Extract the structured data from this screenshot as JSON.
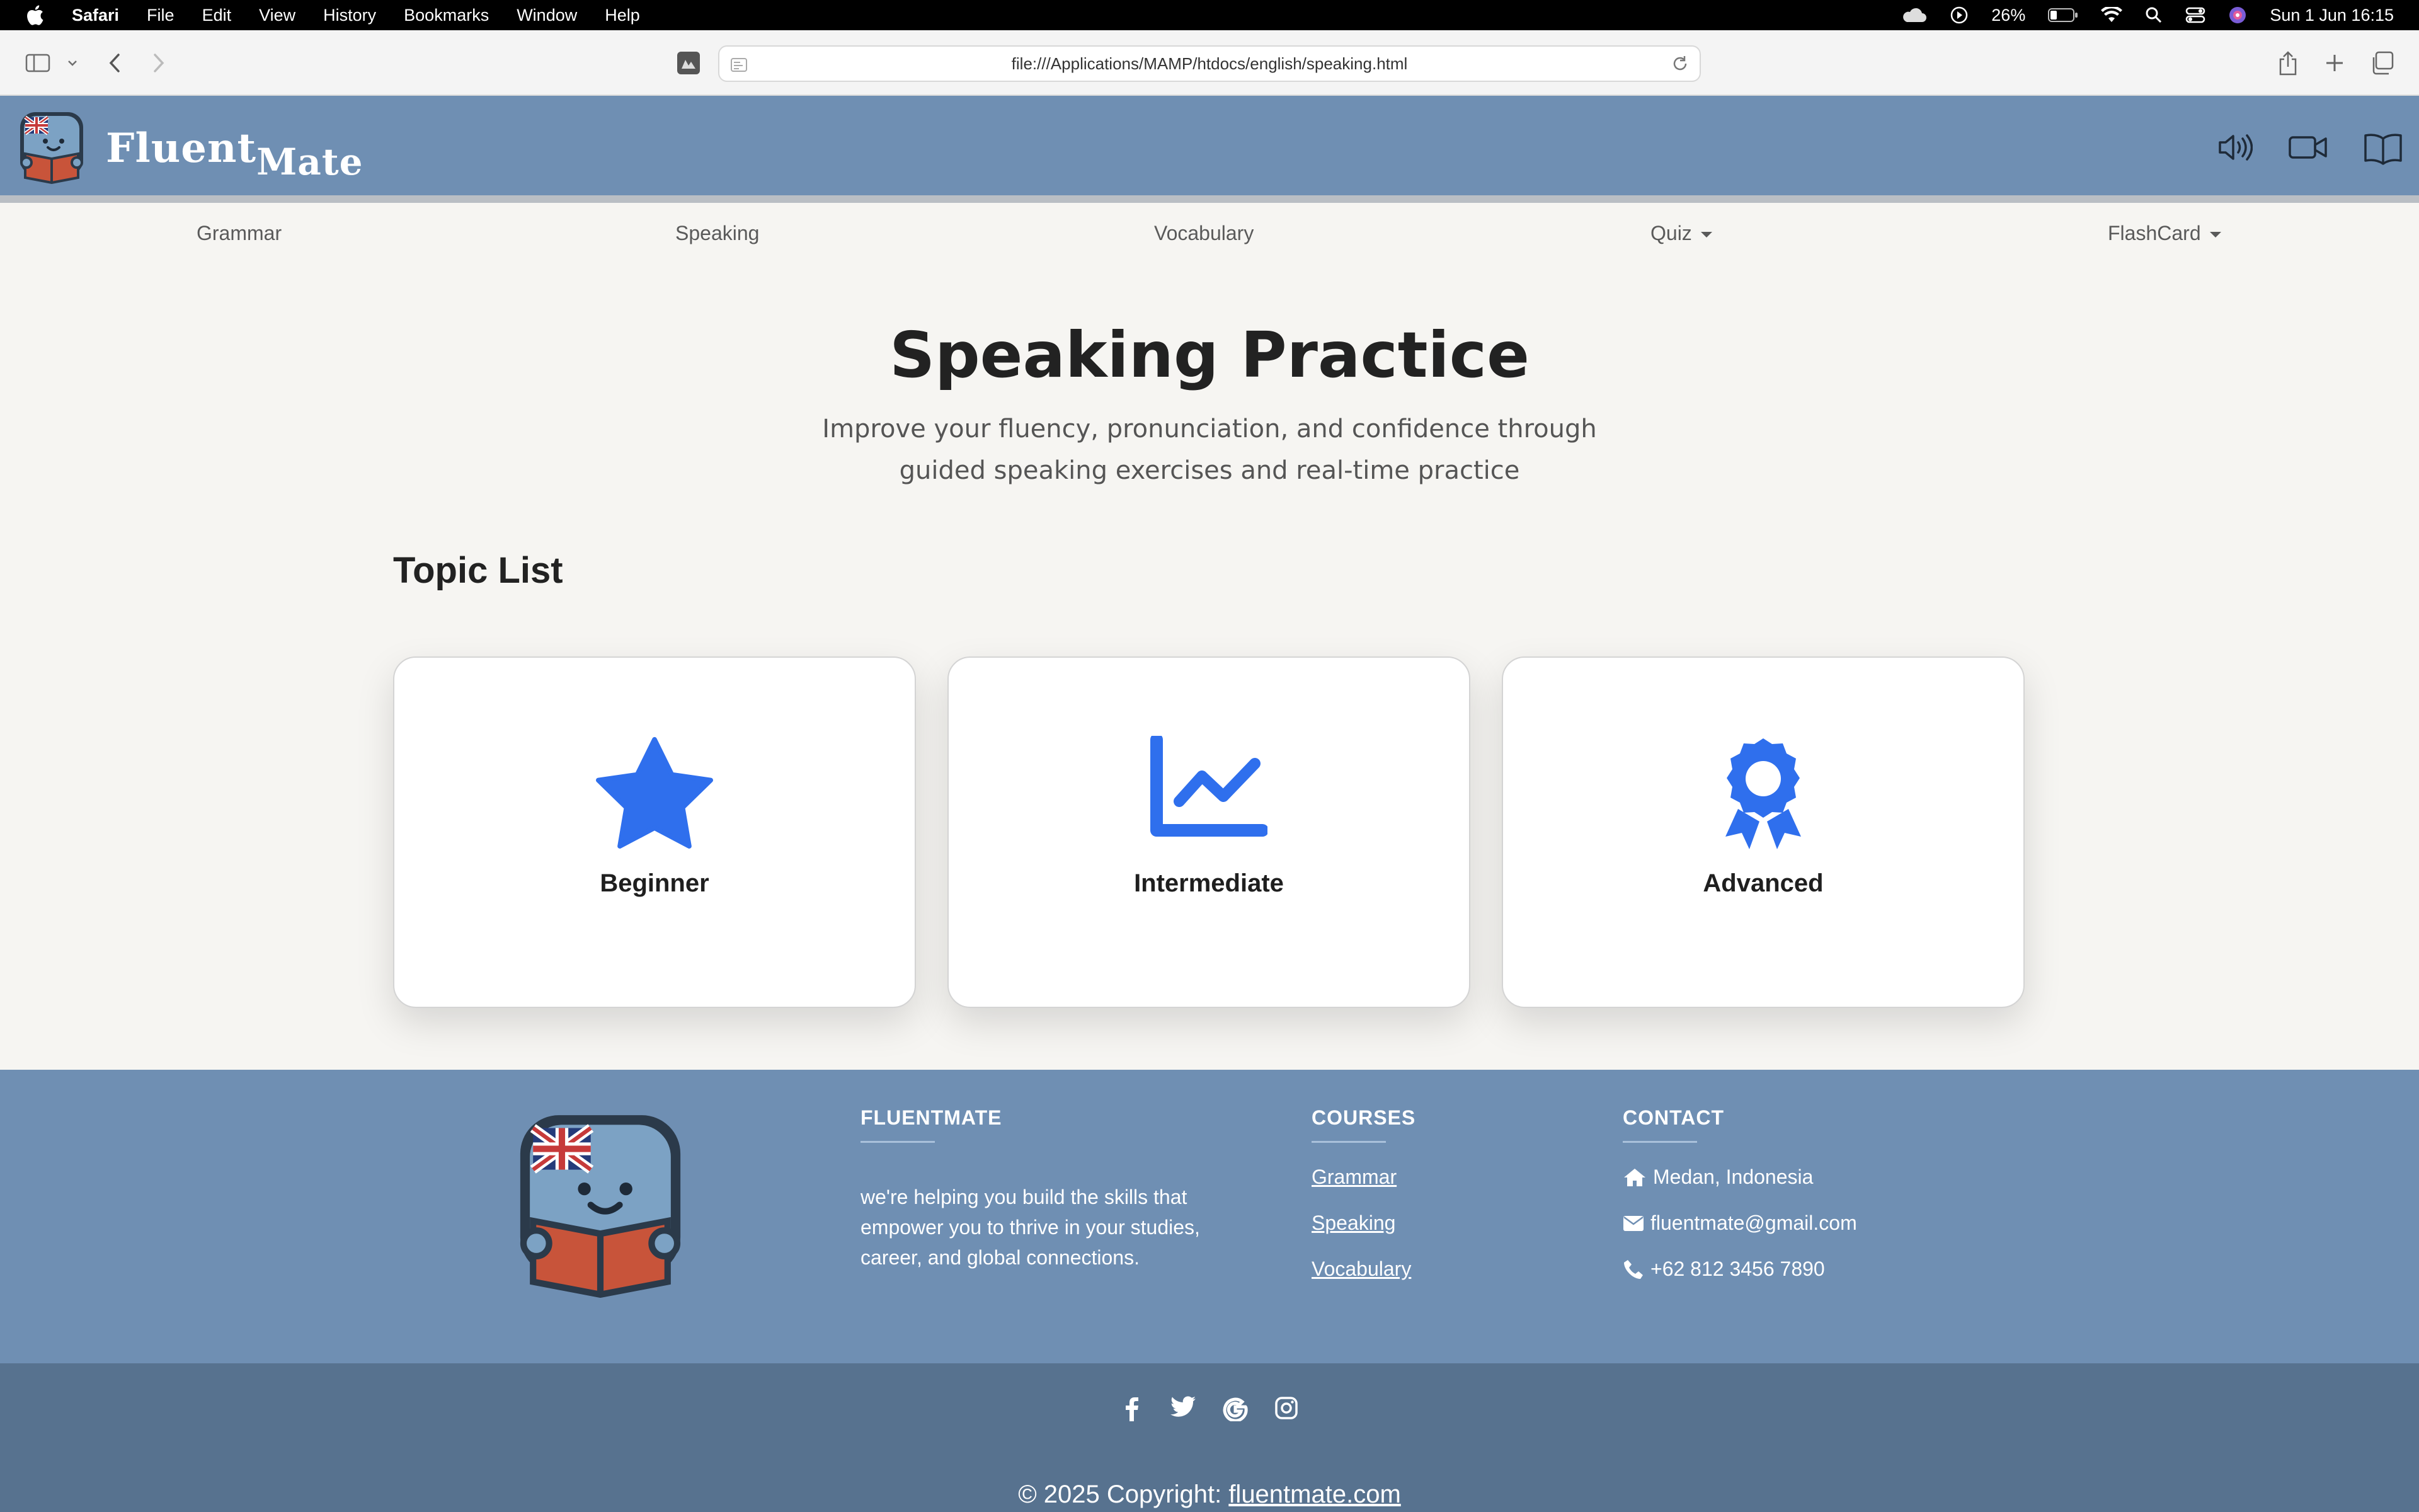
{
  "menubar": {
    "app": "Safari",
    "items": [
      "File",
      "Edit",
      "View",
      "History",
      "Bookmarks",
      "Window",
      "Help"
    ],
    "battery": "26%",
    "datetime": "Sun 1 Jun  16:15"
  },
  "browser": {
    "url": "file:///Applications/MAMP/htdocs/english/speaking.html"
  },
  "header": {
    "brand_main": "Fluent",
    "brand_sub": "Mate"
  },
  "nav": {
    "items": [
      {
        "label": "Grammar"
      },
      {
        "label": "Speaking"
      },
      {
        "label": "Vocabulary"
      },
      {
        "label": "Quiz"
      },
      {
        "label": "FlashCard"
      }
    ]
  },
  "main": {
    "title": "Speaking Practice",
    "subtitle": "Improve your fluency, pronunciation, and confidence through guided speaking exercises and real-time practice",
    "topic_heading": "Topic List",
    "topics": [
      {
        "label": "Beginner",
        "icon": "star-icon"
      },
      {
        "label": "Intermediate",
        "icon": "chart-line-icon"
      },
      {
        "label": "Advanced",
        "icon": "award-icon"
      }
    ],
    "accent": "#2f6fed"
  },
  "footer": {
    "about_heading": "FLUENTMATE",
    "about_text": "we're helping you build the skills that empower you to thrive in your studies, career, and global connections.",
    "courses_heading": "COURSES",
    "courses": [
      "Grammar",
      "Speaking",
      "Vocabulary"
    ],
    "contact_heading": "CONTACT",
    "contact": {
      "address": "Medan, Indonesia",
      "email": "fluentmate@gmail.com",
      "phone": "+62 812 3456 7890"
    },
    "copyright_prefix": "© 2025 Copyright: ",
    "copyright_link": "fluentmate.com"
  },
  "colors": {
    "header_bg": "#6f8fb3",
    "bottom_bar_bg": "#57728f",
    "page_bg": "#f6f5f2"
  }
}
